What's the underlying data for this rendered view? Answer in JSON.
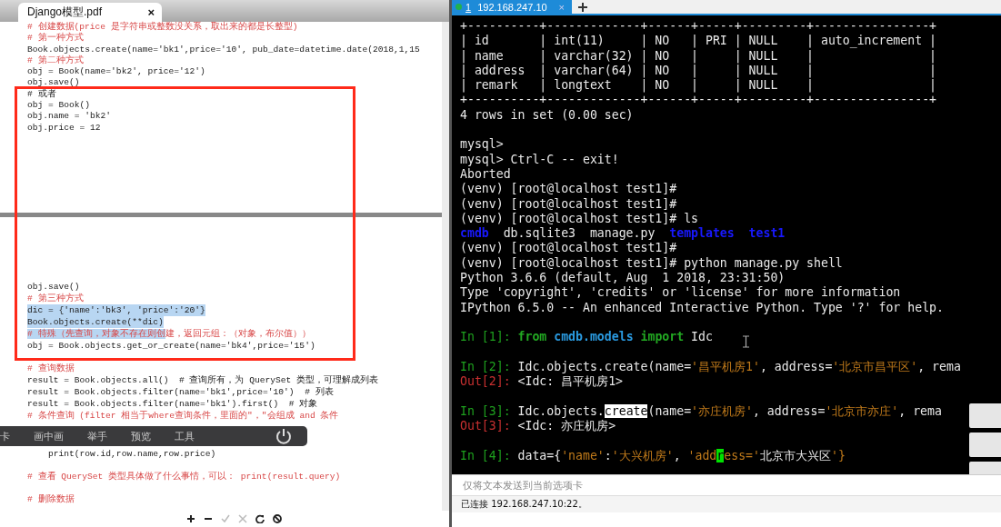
{
  "pdf_viewer": {
    "tab": {
      "title": "Django模型.pdf",
      "close": "×"
    },
    "pages": [
      {
        "lines": [
          {
            "kind": "comment",
            "text": "# 创建数据(price 是字符串或整数没关系，取出来的都是长整型)"
          },
          {
            "kind": "comment",
            "text": "# 第一种方式"
          },
          {
            "kind": "code",
            "text": "Book.objects.create(name='bk1',price='10', pub_date=datetime.date(2018,1,15"
          },
          {
            "kind": "comment",
            "text": "# 第二种方式"
          },
          {
            "kind": "code",
            "text": "obj = Book(name='bk2', price='12')"
          },
          {
            "kind": "code",
            "text": "obj.save()"
          },
          {
            "kind": "code",
            "text": "# 或者"
          },
          {
            "kind": "code",
            "text": "obj = Book()"
          },
          {
            "kind": "code",
            "text": "obj.name = 'bk2'"
          },
          {
            "kind": "code",
            "text": "obj.price = 12"
          }
        ]
      },
      {
        "lines": [
          {
            "kind": "code",
            "text": "obj.save()"
          },
          {
            "kind": "comment",
            "text": "# 第三种方式"
          },
          {
            "kind": "code",
            "text": "dic = {'name':'bk3', 'price':'20'}",
            "highlighted": true
          },
          {
            "kind": "code",
            "text": "Book.objects.create(**dic)",
            "highlighted": true
          },
          {
            "kind": "comment",
            "segments": [
              {
                "text": "# 特殊（先查询，对象不存在则创",
                "highlighted": true
              },
              {
                "text": "建，返回元组：（对象，布尔值））",
                "highlighted": false
              }
            ]
          },
          {
            "kind": "code",
            "text": "obj = Book.objects.get_or_create(name='bk4',price='15')"
          },
          {
            "kind": "blank"
          },
          {
            "kind": "comment",
            "text": "# 查询数据"
          },
          {
            "kind": "code",
            "text": "result = Book.objects.all()  # 查询所有，为 QuerySet 类型，可理解成列表"
          },
          {
            "kind": "code",
            "text": "result = Book.objects.filter(name='bk1',price='10')  # 列表"
          },
          {
            "kind": "code",
            "text": "result = Book.objects.filter(name='bk1').first()  # 对象"
          },
          {
            "kind": "comment",
            "text": "# 条件查询 (filter 相当于where查询条件，里面的\"，\"会组成 and 条件"
          },
          {
            "kind": "code",
            "text": "    print(row.id,row.name,row.price)"
          },
          {
            "kind": "blank"
          },
          {
            "kind": "comment",
            "text": "# 查看 QuerySet 类型具体做了什么事情，可以： print(result.query)"
          },
          {
            "kind": "blank"
          },
          {
            "kind": "comment",
            "text": "# 删除数据"
          }
        ]
      }
    ]
  },
  "meeting_toolbar": {
    "items": [
      "卡",
      "画中画",
      "举手",
      "预览",
      "工具"
    ]
  },
  "terminal": {
    "tab": {
      "number": "1",
      "title": "192.168.247.10",
      "close": "×",
      "selected": true
    },
    "lines": [
      {
        "kind": "text",
        "segments": [
          {
            "kind": "plain",
            "text": "+----------+-------------+------+-----+---------+----------------+"
          }
        ]
      },
      {
        "kind": "text",
        "segments": [
          {
            "kind": "plain",
            "text": "| id       | int(11)     | NO   | PRI | NULL    | auto_increment |"
          }
        ]
      },
      {
        "kind": "text",
        "segments": [
          {
            "kind": "plain",
            "text": "| name     | varchar(32) | NO   |     | NULL    |                |"
          }
        ]
      },
      {
        "kind": "text",
        "segments": [
          {
            "kind": "plain",
            "text": "| address  | varchar(64) | NO   |     | NULL    |                |"
          }
        ]
      },
      {
        "kind": "text",
        "segments": [
          {
            "kind": "plain",
            "text": "| remark   | longtext    | NO   |     | NULL    |                |"
          }
        ]
      },
      {
        "kind": "text",
        "segments": [
          {
            "kind": "plain",
            "text": "+----------+-------------+------+-----+---------+----------------+"
          }
        ]
      },
      {
        "kind": "text",
        "segments": [
          {
            "kind": "plain",
            "text": "4 rows in set (0.00 sec)"
          }
        ]
      },
      {
        "kind": "blank"
      },
      {
        "kind": "text",
        "segments": [
          {
            "kind": "plain",
            "text": "mysql>"
          }
        ]
      },
      {
        "kind": "text",
        "segments": [
          {
            "kind": "plain",
            "text": "mysql> Ctrl-C -- exit!"
          }
        ]
      },
      {
        "kind": "text",
        "segments": [
          {
            "kind": "plain",
            "text": "Aborted"
          }
        ]
      },
      {
        "kind": "text",
        "segments": [
          {
            "kind": "plain",
            "text": "(venv) [root@localhost test1]#"
          }
        ]
      },
      {
        "kind": "text",
        "segments": [
          {
            "kind": "plain",
            "text": "(venv) [root@localhost test1]#"
          }
        ]
      },
      {
        "kind": "text",
        "segments": [
          {
            "kind": "plain",
            "text": "(venv) [root@localhost test1]# ls"
          }
        ]
      },
      {
        "kind": "text",
        "segments": [
          {
            "kind": "dir",
            "text": "cmdb"
          },
          {
            "kind": "plain",
            "text": "  db.sqlite3  manage.py  "
          },
          {
            "kind": "dir",
            "text": "templates  test1"
          }
        ]
      },
      {
        "kind": "text",
        "segments": [
          {
            "kind": "plain",
            "text": "(venv) [root@localhost test1]#"
          }
        ]
      },
      {
        "kind": "text",
        "segments": [
          {
            "kind": "plain",
            "text": "(venv) [root@localhost test1]# python manage.py shell"
          }
        ]
      },
      {
        "kind": "text",
        "segments": [
          {
            "kind": "plain",
            "text": "Python 3.6.6 (default, Aug  1 2018, 23:31:50)"
          }
        ]
      },
      {
        "kind": "text",
        "segments": [
          {
            "kind": "plain",
            "text": "Type 'copyright', 'credits' or 'license' for more information"
          }
        ]
      },
      {
        "kind": "text",
        "segments": [
          {
            "kind": "plain",
            "text": "IPython 6.5.0 -- An enhanced Interactive Python. Type '?' for help."
          }
        ]
      },
      {
        "kind": "blank"
      },
      {
        "kind": "text",
        "segments": [
          {
            "kind": "in",
            "text": "In [1]: "
          },
          {
            "kind": "keyword",
            "text": "from "
          },
          {
            "kind": "module",
            "text": "cmdb.models"
          },
          {
            "kind": "keyword",
            "text": " import"
          },
          {
            "kind": "plain",
            "text": " Idc"
          }
        ]
      },
      {
        "kind": "blank"
      },
      {
        "kind": "text",
        "segments": [
          {
            "kind": "in",
            "text": "In [2]: "
          },
          {
            "kind": "plain",
            "text": "Idc.objects.create(name="
          },
          {
            "kind": "string",
            "text": "'昌平机房1'"
          },
          {
            "kind": "plain",
            "text": ", address="
          },
          {
            "kind": "string",
            "text": "'北京市昌平区'"
          },
          {
            "kind": "plain",
            "text": ", rema"
          }
        ]
      },
      {
        "kind": "text",
        "segments": [
          {
            "kind": "out",
            "text": "Out[2]: "
          },
          {
            "kind": "plain",
            "text": "<Idc: 昌平机房1>"
          }
        ]
      },
      {
        "kind": "blank"
      },
      {
        "kind": "text",
        "segments": [
          {
            "kind": "in",
            "text": "In [3]: "
          },
          {
            "kind": "plain",
            "text": "Idc.objects."
          },
          {
            "kind": "selection",
            "text": "create"
          },
          {
            "kind": "plain",
            "text": "(name="
          },
          {
            "kind": "string",
            "text": "'亦庄机房'"
          },
          {
            "kind": "plain",
            "text": ", address="
          },
          {
            "kind": "string",
            "text": "'北京市亦庄'"
          },
          {
            "kind": "plain",
            "text": ", rema"
          }
        ]
      },
      {
        "kind": "text",
        "segments": [
          {
            "kind": "out",
            "text": "Out[3]: "
          },
          {
            "kind": "plain",
            "text": "<Idc: 亦庄机房>"
          }
        ]
      },
      {
        "kind": "blank"
      },
      {
        "kind": "text",
        "segments": [
          {
            "kind": "in",
            "text": "In [4]: "
          },
          {
            "kind": "plain",
            "text": "data={"
          },
          {
            "kind": "string",
            "text": "'name'"
          },
          {
            "kind": "plain",
            "text": ":"
          },
          {
            "kind": "string",
            "text": "'大兴机房'"
          },
          {
            "kind": "plain",
            "text": ", "
          },
          {
            "kind": "string",
            "text": "'add"
          },
          {
            "kind": "cursor",
            "text": "r"
          },
          {
            "kind": "string",
            "text": "ess='"
          },
          {
            "kind": "plain",
            "text": "北京市大兴区"
          },
          {
            "kind": "string",
            "text": "'}"
          }
        ]
      }
    ],
    "input": {
      "placeholder": "仅将文本发送到当前选项卡"
    },
    "status_bar": "已连接 192.168.247.10:22。"
  }
}
